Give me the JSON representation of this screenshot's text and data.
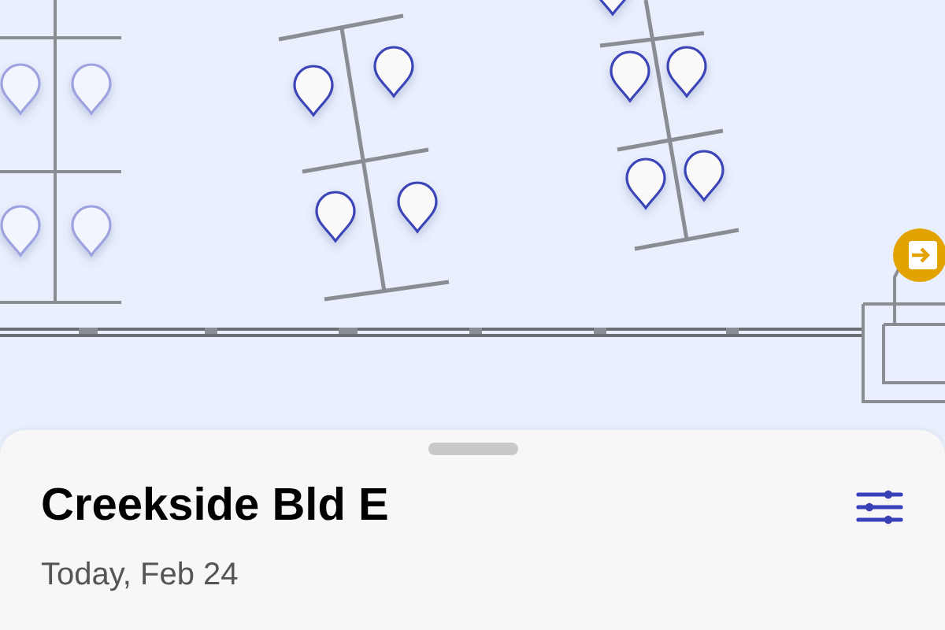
{
  "map": {
    "desks": [
      {
        "dimmed": true
      },
      {
        "dimmed": true
      },
      {
        "dimmed": true
      },
      {
        "dimmed": true
      },
      {
        "dimmed": false
      },
      {
        "dimmed": false
      },
      {
        "dimmed": false
      },
      {
        "dimmed": false
      },
      {
        "dimmed": false
      },
      {
        "dimmed": false
      },
      {
        "dimmed": false
      },
      {
        "dimmed": false
      },
      {
        "dimmed": false
      }
    ]
  },
  "sheet": {
    "title": "Creekside Bld E",
    "subtitle": "Today, Feb 24"
  }
}
